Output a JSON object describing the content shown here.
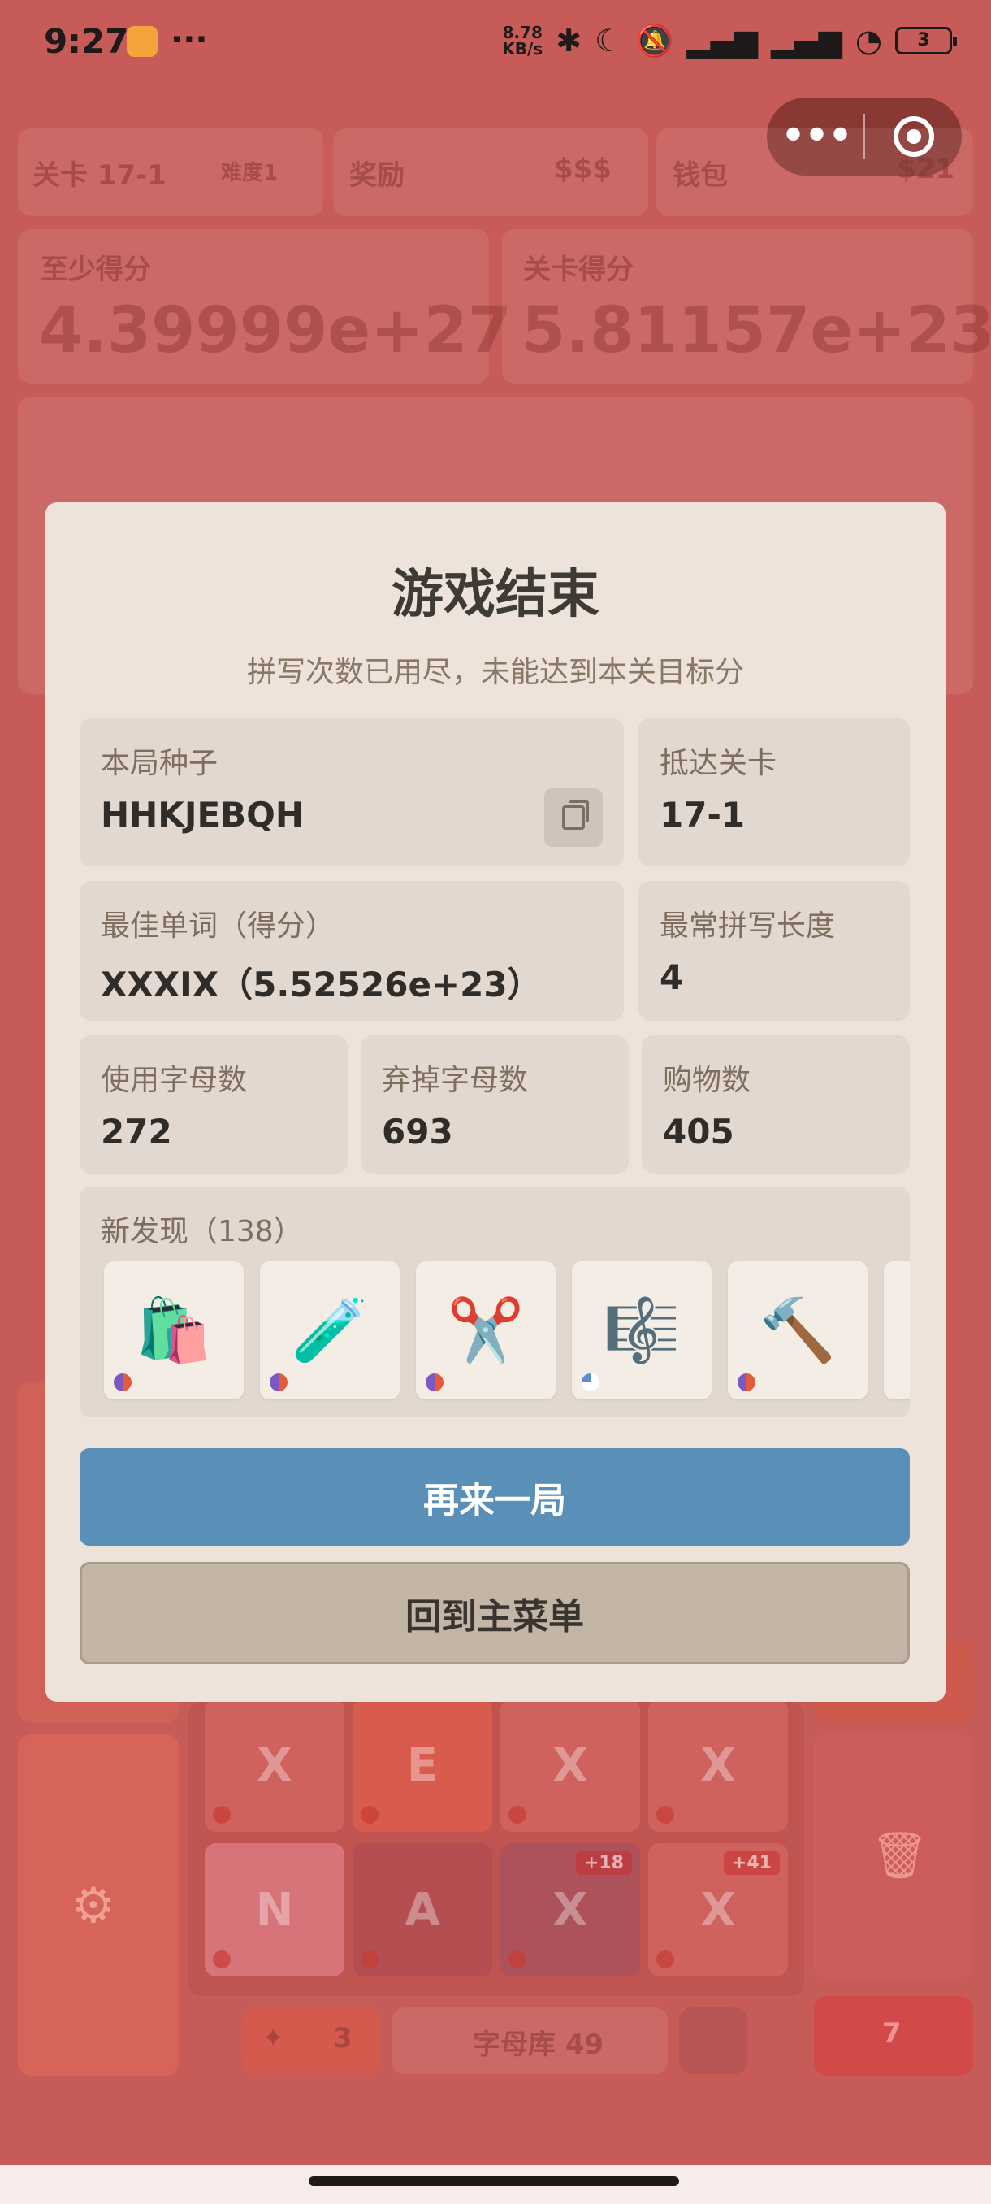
{
  "status_bar": {
    "time": "9:27",
    "more": "···",
    "net_speed_value": "8.78",
    "net_speed_unit": "KB/s",
    "battery": "3",
    "icons": [
      "app-notification-icon",
      "bluetooth-icon",
      "moon-icon",
      "mute-bell-icon",
      "hd-signal-icon",
      "hd-signal-icon",
      "wifi-icon",
      "battery-icon"
    ]
  },
  "capsule": {
    "more_icon": "more-dots-icon",
    "close_icon": "target-circle-icon"
  },
  "background": {
    "level_label": "关卡 17-1",
    "difficulty": "难度1",
    "reward_label": "奖励",
    "reward_value": "$$$",
    "wallet_label": "钱包",
    "wallet_value": "$21",
    "min_score_label": "至少得分",
    "min_score_value": "4.39999e+27",
    "level_score_label": "关卡得分",
    "level_score_value": "5.81157e+23",
    "tiles_row1": [
      "X",
      "E",
      "X",
      "X"
    ],
    "tiles_row2": [
      "N",
      "A",
      "X",
      "X"
    ],
    "tile_badges": [
      "+18",
      "+41"
    ],
    "hint_count": "3",
    "letter_pool": "字母库 49",
    "remaining": "7"
  },
  "modal": {
    "title": "游戏结束",
    "subtitle": "拼写次数已用尽，未能达到本关目标分",
    "seed_label": "本局种子",
    "seed_value": "HHKJEBQH",
    "reached_label": "抵达关卡",
    "reached_value": "17-1",
    "best_word_label": "最佳单词（得分）",
    "best_word_value": "XXXIX（5.52526e+23）",
    "common_length_label": "最常拼写长度",
    "common_length_value": "4",
    "letters_used_label": "使用字母数",
    "letters_used_value": "272",
    "letters_discarded_label": "弃掉字母数",
    "letters_discarded_value": "693",
    "purchases_label": "购物数",
    "purchases_value": "405",
    "discoveries_label": "新发现（138）",
    "discoveries": [
      {
        "icon": "shopping-bags-icon",
        "glyph": "🛍️"
      },
      {
        "icon": "test-tube-icon",
        "glyph": "🧪"
      },
      {
        "icon": "scissors-icon",
        "glyph": "✂️"
      },
      {
        "icon": "music-score-icon",
        "glyph": "🎼"
      },
      {
        "icon": "hammer-icon",
        "glyph": "🔨"
      }
    ],
    "play_again": "再来一局",
    "main_menu": "回到主菜单"
  },
  "colors": {
    "overlay": "#c65b57",
    "modal_bg": "#ede3da",
    "stat_bg": "#e2d8cf",
    "primary_button": "#5a90b8",
    "secondary_button": "#c4b6a7"
  }
}
